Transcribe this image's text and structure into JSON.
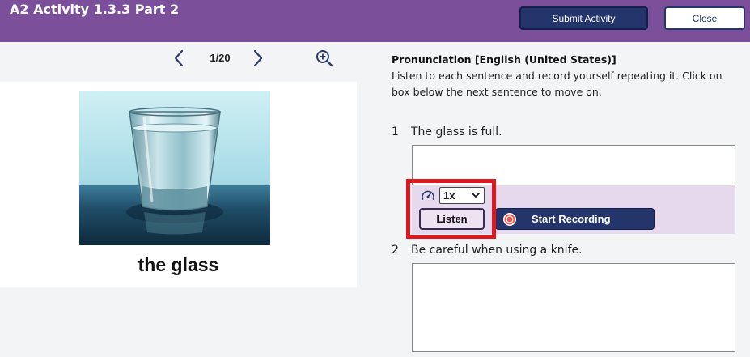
{
  "header": {
    "title": "A2 Activity 1.3.3 Part 2",
    "submit_label": "Submit Activity",
    "close_label": "Close"
  },
  "pager": {
    "current": "1/20"
  },
  "card": {
    "caption": "the glass"
  },
  "instructions": {
    "title": "Pronunciation [English (United States)]",
    "text": "Listen to each sentence and record yourself repeating it. Click on box below the next sentence to move on."
  },
  "questions": [
    {
      "number": "1",
      "text": "The glass is full."
    },
    {
      "number": "2",
      "text": "Be careful when using a knife."
    }
  ],
  "recorder": {
    "speed": "1x",
    "listen_label": "Listen",
    "record_label": "Start Recording"
  },
  "colors": {
    "header_bg": "#7b4f9a",
    "primary_button": "#23356b",
    "highlight": "#e0171f",
    "recorder_bg": "#e6d9ee"
  },
  "icons": [
    "chevron-left-icon",
    "chevron-right-icon",
    "zoom-in-icon",
    "speedometer-icon",
    "chevron-down-icon",
    "record-icon"
  ]
}
